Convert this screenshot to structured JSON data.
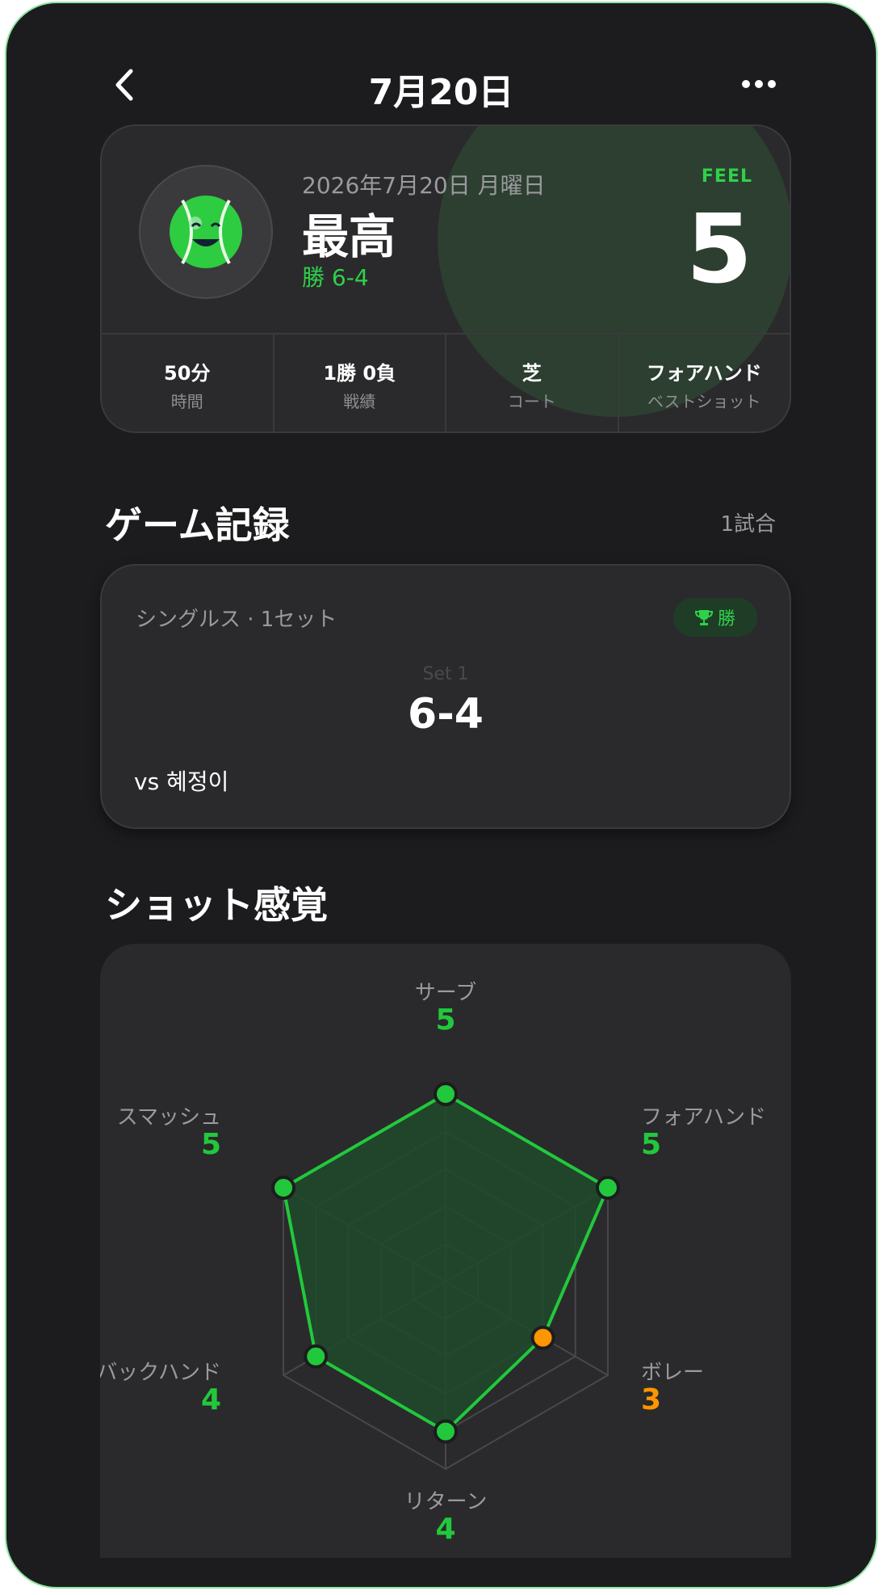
{
  "header": {
    "title": "7月20日"
  },
  "summary": {
    "date": "2026年7月20日 月曜日",
    "mood": "最高",
    "result": "勝 6-4",
    "feel_label": "FEEL",
    "feel_value": "5",
    "stats": [
      {
        "value": "50分",
        "label": "時間"
      },
      {
        "value": "1勝 0負",
        "label": "戦績"
      },
      {
        "value": "芝",
        "label": "コート"
      },
      {
        "value": "フォアハンド",
        "label": "ベストショット"
      }
    ]
  },
  "games_section": {
    "title": "ゲーム記録",
    "count": "1試合"
  },
  "game": {
    "type": "シングルス · 1セット",
    "badge": "勝",
    "set_label": "Set 1",
    "set_score": "6-4",
    "opponent": "vs 혜정이"
  },
  "shots_section": {
    "title": "ショット感覚"
  },
  "chart_data": {
    "type": "radar",
    "max": 5,
    "categories": [
      "サーブ",
      "フォアハンド",
      "ボレー",
      "リターン",
      "バックハンド",
      "スマッシュ"
    ],
    "values": [
      5,
      5,
      3,
      4,
      4,
      5
    ],
    "colors": {
      "fill": "#1e4a2c",
      "line": "#22c83c",
      "high": "#22c83c",
      "low": "#ff9500"
    }
  }
}
